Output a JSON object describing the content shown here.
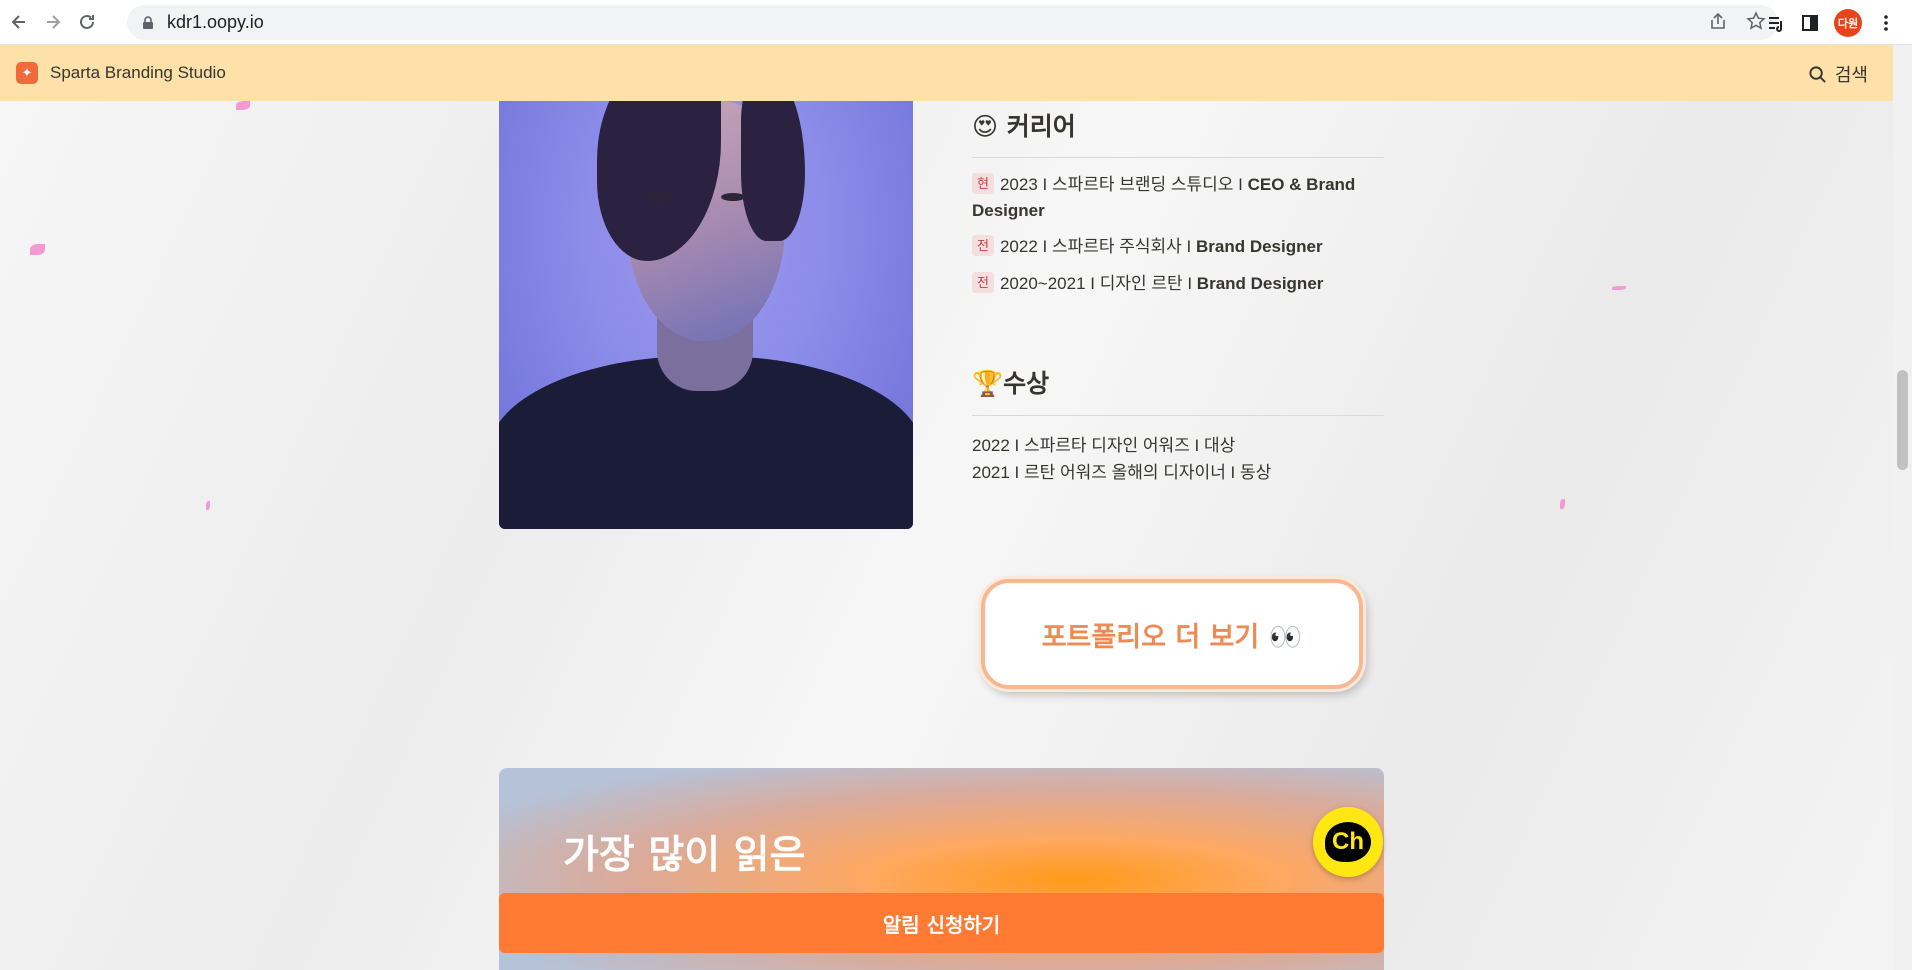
{
  "browser": {
    "url": "kdr1.oopy.io",
    "profile_label": "다원",
    "icons": [
      "back-icon",
      "forward-icon",
      "reload-icon",
      "lock-icon",
      "share-icon",
      "star-icon",
      "reading-list-icon",
      "side-panel-icon",
      "menu-dots-icon"
    ]
  },
  "site_header": {
    "title": "Sparta Branding Studio",
    "search_label": "검색"
  },
  "career": {
    "heading_emoji": "😍",
    "heading": "커리어",
    "items": [
      {
        "tag": "현",
        "text": "2023 I 스파르타 브랜딩 스튜디오 I ",
        "role": "CEO & Brand Designer"
      },
      {
        "tag": "전",
        "text": "2022 I 스파르타 주식회사 I ",
        "role": "Brand Designer"
      },
      {
        "tag": "전",
        "text": "2020~2021 I 디자인 르탄 I ",
        "role": "Brand Designer"
      }
    ]
  },
  "awards": {
    "heading_emoji": "🏆",
    "heading": "수상",
    "items": [
      "2022 I 스파르타 디자인 어워즈 I 대상",
      "2021 I 르탄 어워즈 올해의 디자이너 I 동상"
    ]
  },
  "portfolio_button": {
    "label": "포트폴리오 더 보기 👀"
  },
  "banner": {
    "heading": "가장 많이 읽은"
  },
  "notify_button": {
    "label": "알림 신청하기"
  },
  "channel_button": {
    "label": "Ch"
  },
  "colors": {
    "header_bg": "#fde1a8",
    "accent_orange": "#ff7a33",
    "portfolio_text": "#ee8a55",
    "tag_red": "#c9404a",
    "channel_yellow": "#ffe812"
  }
}
